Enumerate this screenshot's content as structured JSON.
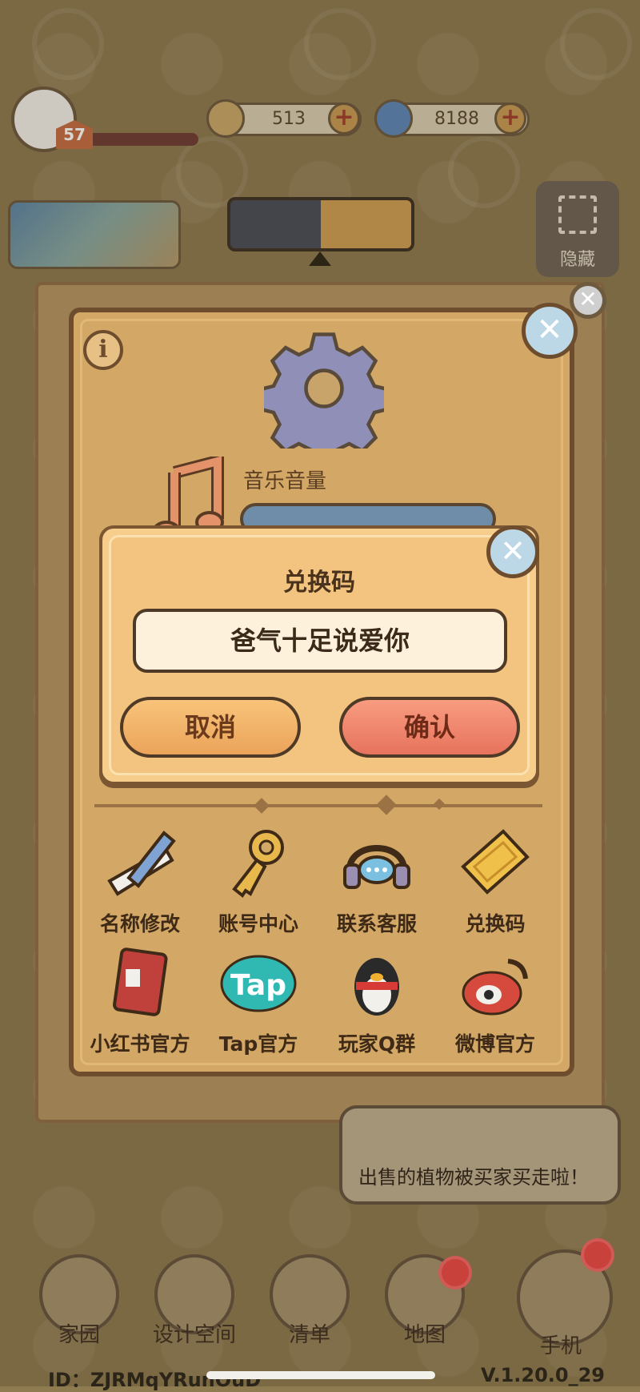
{
  "hud": {
    "level": "57",
    "coins": "513",
    "gems": "8188"
  },
  "hide_button": {
    "label": "隐藏"
  },
  "settings": {
    "volume_label": "音乐音量",
    "grid": [
      {
        "label": "名称修改",
        "icon": "pencil-icon"
      },
      {
        "label": "账号中心",
        "icon": "key-icon"
      },
      {
        "label": "联系客服",
        "icon": "headset-icon"
      },
      {
        "label": "兑换码",
        "icon": "ticket-icon"
      },
      {
        "label": "小红书官方",
        "icon": "book-icon"
      },
      {
        "label": "Tap官方",
        "icon": "tap-logo-icon"
      },
      {
        "label": "玩家Q群",
        "icon": "penguin-icon"
      },
      {
        "label": "微博官方",
        "icon": "weibo-icon"
      }
    ]
  },
  "dialog": {
    "title": "兑换码",
    "code_value": "爸气十足说爱你",
    "cancel_label": "取消",
    "confirm_label": "确认"
  },
  "notification": {
    "text": "出售的植物被买家买走啦！"
  },
  "bottom_nav": [
    {
      "label": "家园"
    },
    {
      "label": "设计空间"
    },
    {
      "label": "清单"
    },
    {
      "label": "地图"
    },
    {
      "label": "手机"
    }
  ],
  "footer": {
    "id_text": "ID：ZJRMqYRunOuD",
    "version": "V.1.20.0_29"
  },
  "colors": {
    "panel": "#d3a866",
    "dialog": "#f6cd8a",
    "cancel": "#eba45a",
    "confirm": "#e7735d"
  }
}
